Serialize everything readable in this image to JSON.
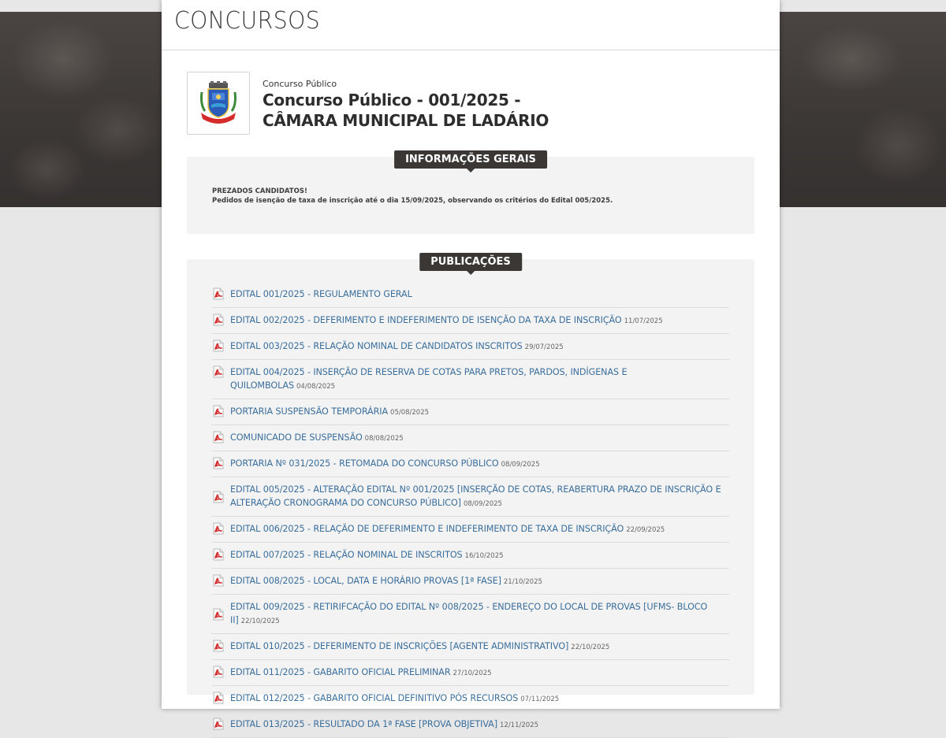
{
  "header": {
    "title": "CONCURSOS"
  },
  "contest": {
    "type_label": "Concurso Público",
    "title": "Concurso Público - 001/2025 - CÂMARA MUNICIPAL DE LADÁRIO"
  },
  "info": {
    "tab_label": "INFORMAÇÕES GERAIS",
    "line1": "PREZADOS CANDIDATOS!",
    "line2": "Pedidos de isenção de taxa de inscrição até o dia 15/09/2025, observando os critérios do Edital 005/2025."
  },
  "publications": {
    "tab_label": "PUBLICAÇÕES",
    "items": [
      {
        "title": "EDITAL 001/2025 - REGULAMENTO GERAL",
        "date": ""
      },
      {
        "title": "EDITAL 002/2025 - DEFERIMENTO E INDEFERIMENTO DE ISENÇÃO DA TAXA DE INSCRIÇÃO",
        "date": "11/07/2025"
      },
      {
        "title": "EDITAL 003/2025 - RELAÇÃO NOMINAL DE CANDIDATOS INSCRITOS",
        "date": "29/07/2025"
      },
      {
        "title": "EDITAL 004/2025 - INSERÇÃO DE RESERVA DE COTAS PARA PRETOS, PARDOS, INDÍGENAS E QUILOMBOLAS",
        "date": "04/08/2025"
      },
      {
        "title": "PORTARIA SUSPENSÃO TEMPORÁRIA",
        "date": "05/08/2025"
      },
      {
        "title": "COMUNICADO DE SUSPENSÃO",
        "date": "08/08/2025"
      },
      {
        "title": "PORTARIA Nº 031/2025 - RETOMADA DO CONCURSO PÚBLICO",
        "date": "08/09/2025"
      },
      {
        "title": "EDITAL 005/2025 - ALTERAÇÃO EDITAL Nº 001/2025 [INSERÇÃO DE COTAS, REABERTURA PRAZO DE INSCRIÇÃO E ALTERAÇÃO CRONOGRAMA DO CONCURSO PÚBLICO]",
        "date": "08/09/2025"
      },
      {
        "title": "EDITAL 006/2025 - RELAÇÃO DE DEFERIMENTO E INDEFERIMENTO DE TAXA DE INSCRIÇÃO",
        "date": "22/09/2025"
      },
      {
        "title": "EDITAL 007/2025 - RELAÇÃO NOMINAL DE INSCRITOS",
        "date": "16/10/2025"
      },
      {
        "title": "EDITAL 008/2025 - LOCAL, DATA E HORÁRIO PROVAS [1ª FASE]",
        "date": "21/10/2025"
      },
      {
        "title": "EDITAL 009/2025 - RETIRIFCAÇÃO DO EDITAL Nº 008/2025 - ENDEREÇO DO LOCAL DE PROVAS [UFMS- BLOCO II]",
        "date": "22/10/2025"
      },
      {
        "title": "EDITAL 010/2025 - DEFERIMENTO DE INSCRIÇÕES [AGENTE ADMINISTRATIVO]",
        "date": "22/10/2025"
      },
      {
        "title": "EDITAL 011/2025 - GABARITO OFICIAL PRELIMINAR",
        "date": "27/10/2025"
      },
      {
        "title": "EDITAL 012/2025 - GABARITO OFICIAL DEFINITIVO PÓS RECURSOS",
        "date": "07/11/2025"
      },
      {
        "title": "EDITAL 013/2025 - RESULTADO DA 1ª FASE [PROVA OBJETIVA]",
        "date": "12/11/2025"
      }
    ]
  },
  "icons": {
    "publication": "pdf-icon",
    "logo": "municipal-coat-of-arms"
  },
  "colors": {
    "link": "#3a6e9c",
    "tab_bg": "#3b3735",
    "hero_bg": "#3b3735"
  }
}
